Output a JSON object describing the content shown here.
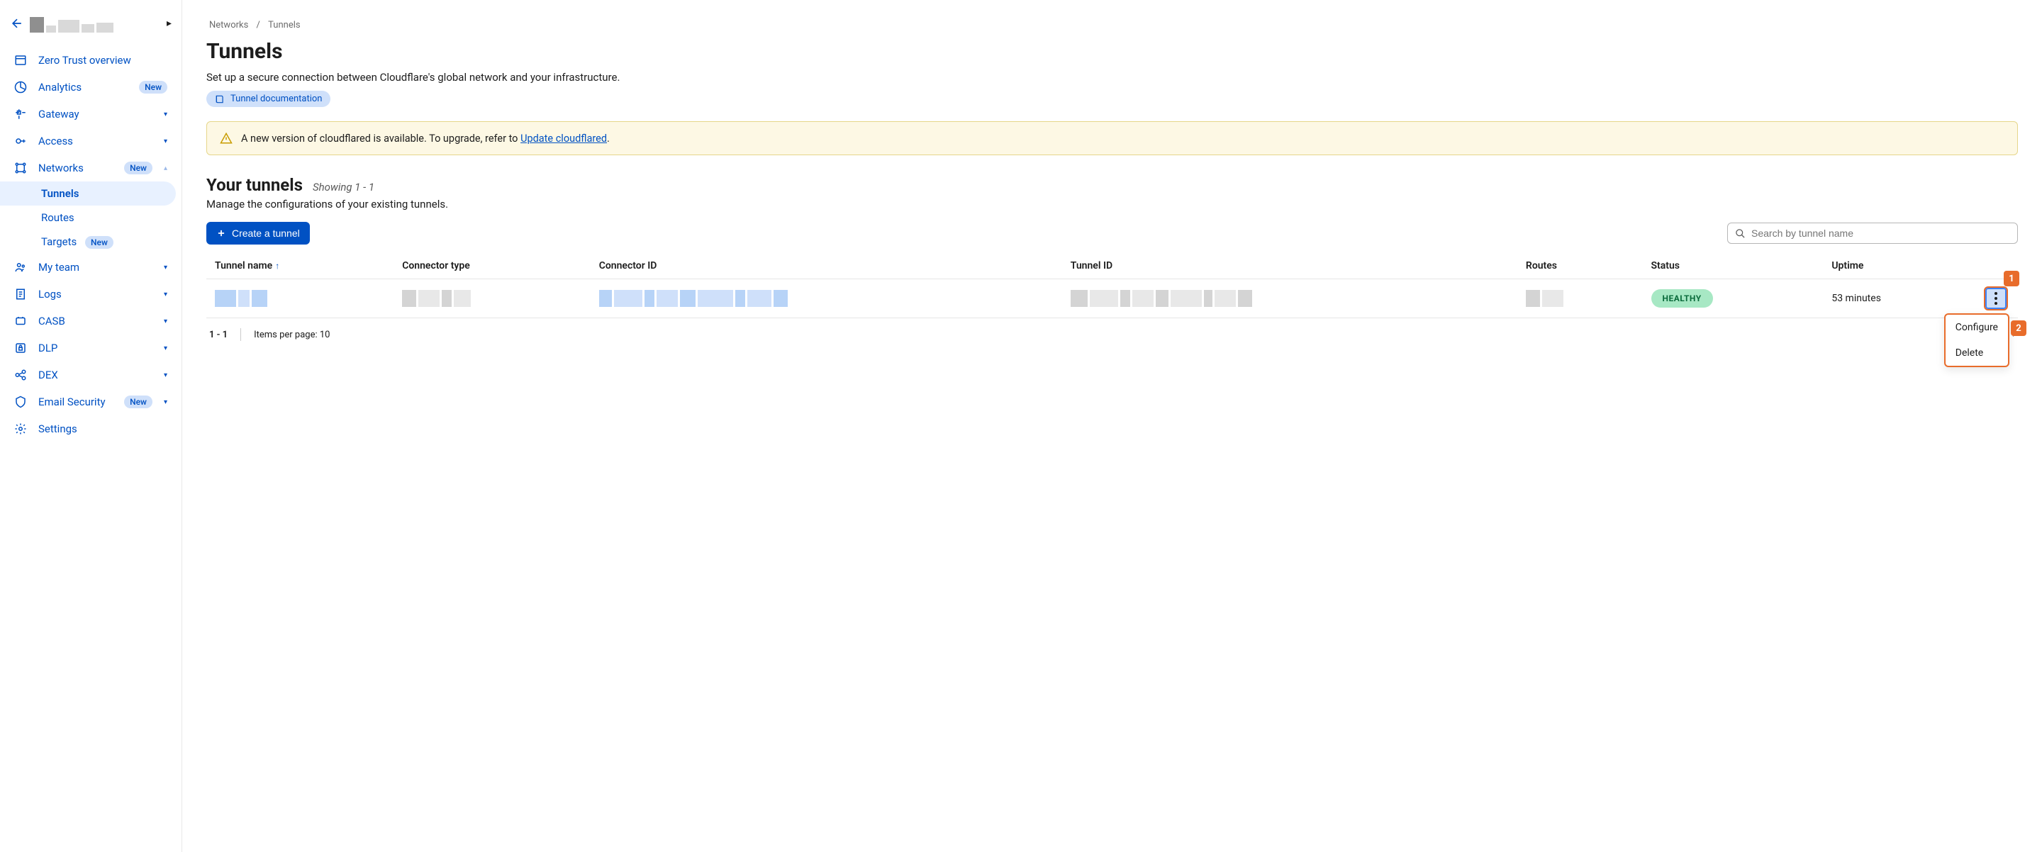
{
  "sidebar": {
    "items": [
      {
        "label": "Zero Trust overview",
        "badge": null,
        "expandable": false
      },
      {
        "label": "Analytics",
        "badge": "New",
        "expandable": false
      },
      {
        "label": "Gateway",
        "badge": null,
        "expandable": true
      },
      {
        "label": "Access",
        "badge": null,
        "expandable": true
      },
      {
        "label": "Networks",
        "badge": "New",
        "expandable": true,
        "expanded": true,
        "children": [
          {
            "label": "Tunnels",
            "active": true,
            "badge": null
          },
          {
            "label": "Routes",
            "active": false,
            "badge": null
          },
          {
            "label": "Targets",
            "active": false,
            "badge": "New"
          }
        ]
      },
      {
        "label": "My team",
        "badge": null,
        "expandable": true
      },
      {
        "label": "Logs",
        "badge": null,
        "expandable": true
      },
      {
        "label": "CASB",
        "badge": null,
        "expandable": true
      },
      {
        "label": "DLP",
        "badge": null,
        "expandable": true
      },
      {
        "label": "DEX",
        "badge": null,
        "expandable": true
      },
      {
        "label": "Email Security",
        "badge": "New",
        "expandable": true
      },
      {
        "label": "Settings",
        "badge": null,
        "expandable": false
      }
    ]
  },
  "breadcrumb": {
    "parent": "Networks",
    "current": "Tunnels"
  },
  "page": {
    "title": "Tunnels",
    "description": "Set up a secure connection between Cloudflare's global network and your infrastructure.",
    "doc_label": "Tunnel documentation"
  },
  "alert": {
    "text_before": "A new version of cloudflared is available. To upgrade, refer to ",
    "link_text": "Update cloudflared",
    "text_after": "."
  },
  "section": {
    "heading": "Your tunnels",
    "showing": "Showing 1 - 1",
    "description": "Manage the configurations of your existing tunnels.",
    "create_label": "Create a tunnel",
    "search_placeholder": "Search by tunnel name"
  },
  "table": {
    "columns": [
      "Tunnel name",
      "Connector type",
      "Connector ID",
      "Tunnel ID",
      "Routes",
      "Status",
      "Uptime"
    ],
    "sort_column": "Tunnel name",
    "rows": [
      {
        "status": "HEALTHY",
        "uptime": "53 minutes"
      }
    ]
  },
  "actions_menu": {
    "items": [
      "Configure",
      "Delete"
    ]
  },
  "callouts": {
    "one": "1",
    "two": "2"
  },
  "pager": {
    "range": "1 - 1",
    "items_per_page": "Items per page: 10"
  }
}
